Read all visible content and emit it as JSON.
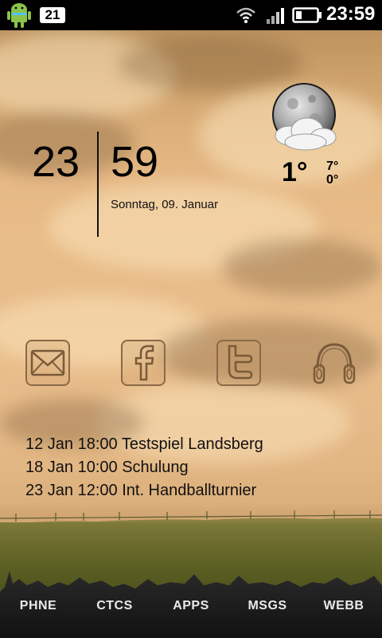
{
  "status_bar": {
    "notification_count": "21",
    "time": "23:59",
    "icons": [
      "android-icon",
      "wifi-icon",
      "signal-icon",
      "battery-icon"
    ]
  },
  "clock": {
    "hours": "23",
    "minutes": "59",
    "date": "Sonntag, 09. Januar"
  },
  "weather": {
    "icon": "moon-cloud-icon",
    "temperature": "1°",
    "high": "7°",
    "low": "0°"
  },
  "app_icons": [
    "mail-icon",
    "facebook-icon",
    "twitter-icon",
    "headphones-icon"
  ],
  "agenda": [
    "12 Jan 18:00 Testspiel Landsberg",
    "18 Jan 10:00 Schulung",
    "23 Jan 12:00 Int. Handballturnier"
  ],
  "dock": {
    "items": [
      "PHNE",
      "CTCS",
      "APPS",
      "MSGS",
      "WEBB"
    ]
  },
  "colors": {
    "status_bar": "#000000",
    "sky": "#e6b985",
    "field": "#5a5e22",
    "dock": "#1c1c1c",
    "dock_text": "#eaeaea"
  }
}
